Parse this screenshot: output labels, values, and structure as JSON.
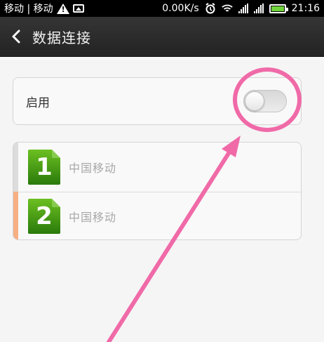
{
  "status_bar": {
    "carriers": "移动 | 移动",
    "speed": "0.00K/s",
    "time": "21:16",
    "icons": [
      "warning-icon",
      "image-icon",
      "alarm-icon",
      "wifi-icon",
      "signal-icon",
      "signal-icon",
      "battery-icon"
    ]
  },
  "titlebar": {
    "back_icon": "chevron-left-icon",
    "title": "数据连接"
  },
  "enable": {
    "label": "启用",
    "toggle_on": false
  },
  "sims": [
    {
      "number": "1",
      "carrier": "中国移动",
      "marker_color": "#dcdcdc"
    },
    {
      "number": "2",
      "carrier": "中国移动",
      "marker_color": "#f6b083"
    }
  ],
  "colors": {
    "sim_green_light": "#67b51e",
    "sim_green_dark": "#2d7d0c",
    "annotation_pink": "#f06aa8",
    "titlebar": "#2b2b2b"
  }
}
